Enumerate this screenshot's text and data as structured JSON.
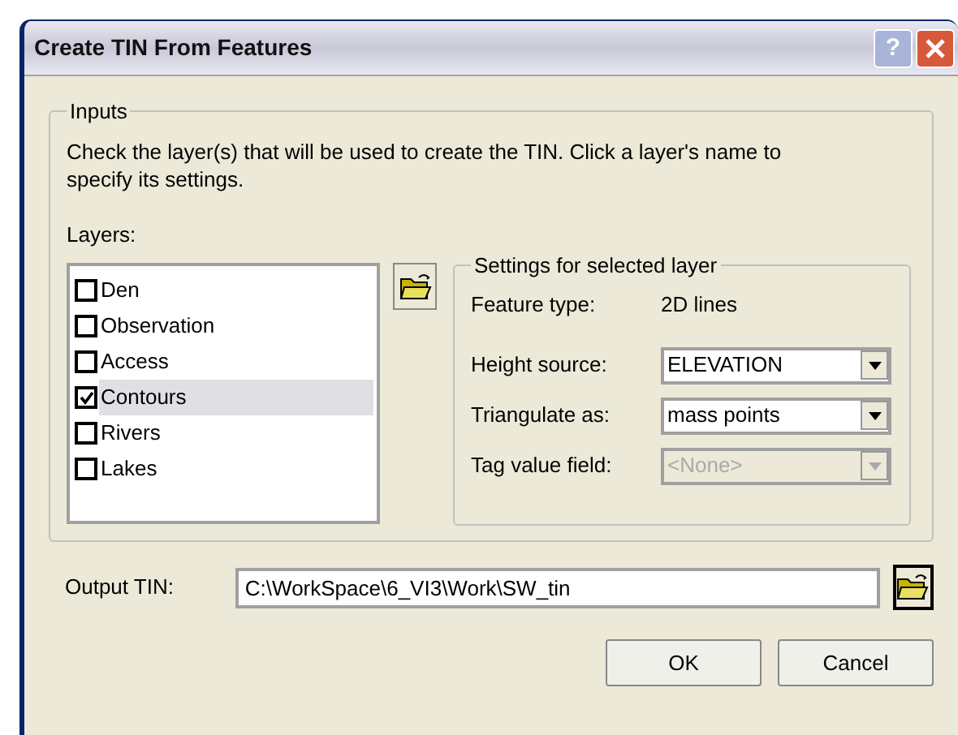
{
  "window": {
    "title": "Create TIN From Features",
    "controls": [
      "?"
    ]
  },
  "inputs": {
    "legend": "Inputs",
    "instructions": "Check the layer(s) that will be used to create the TIN.  Click a layer's name to specify its settings.",
    "layers_label": "Layers:",
    "layers": [
      {
        "name": "Den",
        "checked": false,
        "selected": false
      },
      {
        "name": "Observation",
        "checked": false,
        "selected": false
      },
      {
        "name": "Access",
        "checked": false,
        "selected": false
      },
      {
        "name": "Contours",
        "checked": true,
        "selected": true
      },
      {
        "name": "Rivers",
        "checked": false,
        "selected": false
      },
      {
        "name": "Lakes",
        "checked": false,
        "selected": false
      }
    ],
    "settings": {
      "legend": "Settings for selected layer",
      "feature_type_label": "Feature type:",
      "feature_type": "2D lines",
      "fields": [
        {
          "label": "Height source:",
          "value": "ELEVATION",
          "disabled": false
        },
        {
          "label": "Triangulate as:",
          "value": "mass points",
          "disabled": false
        },
        {
          "label": "Tag value field:",
          "value": "<None>",
          "disabled": true
        }
      ]
    }
  },
  "output": {
    "label": "Output TIN:",
    "value": "C:\\WorkSpace\\6_VI3\\Work\\SW_tin"
  },
  "buttons": [
    "OK",
    "Cancel"
  ]
}
